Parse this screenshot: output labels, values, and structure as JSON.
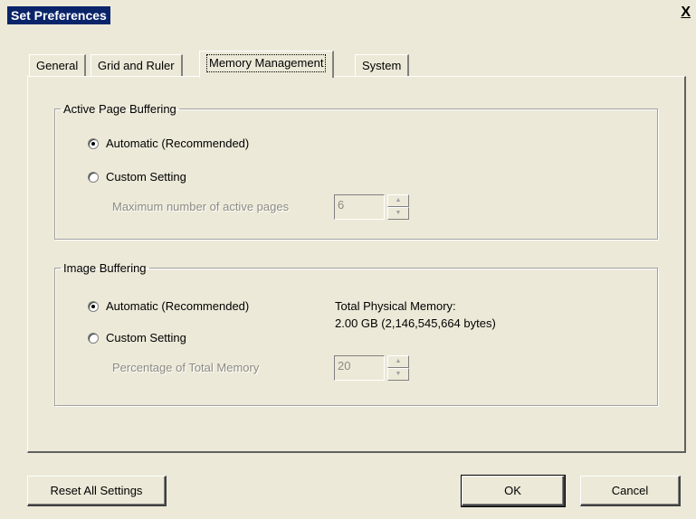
{
  "window": {
    "title": "Set Preferences",
    "close_glyph": "X"
  },
  "tabs": [
    {
      "label": "General"
    },
    {
      "label": "Grid and Ruler"
    },
    {
      "label": "Memory Management"
    },
    {
      "label": "System"
    }
  ],
  "active_tab": "Memory Management",
  "active_page_buffering": {
    "legend": "Active Page Buffering",
    "auto_label": "Automatic (Recommended)",
    "auto_selected": true,
    "custom_label": "Custom Setting",
    "custom_selected": false,
    "max_pages_label": "Maximum number of active pages",
    "max_pages_value": "6"
  },
  "image_buffering": {
    "legend": "Image Buffering",
    "auto_label": "Automatic (Recommended)",
    "auto_selected": true,
    "custom_label": "Custom Setting",
    "custom_selected": false,
    "memory_title": "Total Physical Memory:",
    "memory_value": "2.00 GB (2,146,545,664 bytes)",
    "percentage_label": "Percentage of Total Memory",
    "percentage_value": "20"
  },
  "buttons": {
    "reset": "Reset All Settings",
    "ok": "OK",
    "cancel": "Cancel"
  },
  "icons": {
    "spin_up": "▲",
    "spin_down": "▼"
  }
}
